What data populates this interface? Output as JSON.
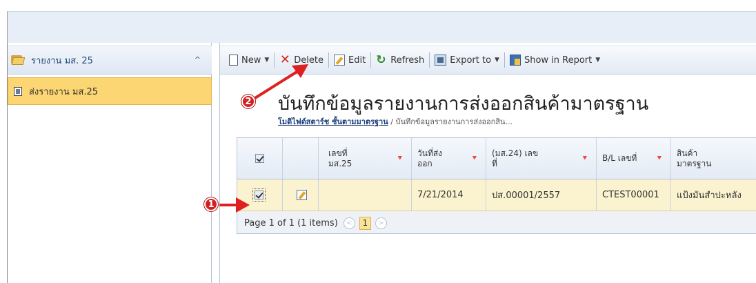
{
  "sidebar": {
    "header": "รายงาน มส. 25",
    "item": "ส่งรายงาน มส.25"
  },
  "toolbar": {
    "new": "New",
    "delete": "Delete",
    "edit": "Edit",
    "refresh": "Refresh",
    "export": "Export to",
    "report": "Show in Report"
  },
  "page": {
    "title": "บันทึกข้อมูลรายงานการส่งออกสินค้ามาตรฐาน",
    "breadcrumb_link": "โมดิไฟด์สตาร์ช ชั้นตามมาตรฐาน",
    "breadcrumb_sep": " / ",
    "breadcrumb_current": "บันทึกข้อมูลรายงานการส่งออกสิน..."
  },
  "grid": {
    "columns": [
      "เลขที่ มส.25",
      "วันที่ส่ง ออก",
      "(มส.24) เลข ที่",
      "B/L เลขที่",
      "สินค้า มาตรฐาน"
    ],
    "row": {
      "doc_no": "",
      "export_date": "7/21/2014",
      "ms24_no": "ปส.00001/2557",
      "bl_no": "CTEST00001",
      "product": "แป้งมันสำปะหลัง"
    },
    "pager": {
      "text": "Page 1 of 1 (1 items)",
      "current": "1"
    }
  },
  "annotations": {
    "badge1": "1",
    "badge2": "2",
    "color": "#e02020"
  }
}
